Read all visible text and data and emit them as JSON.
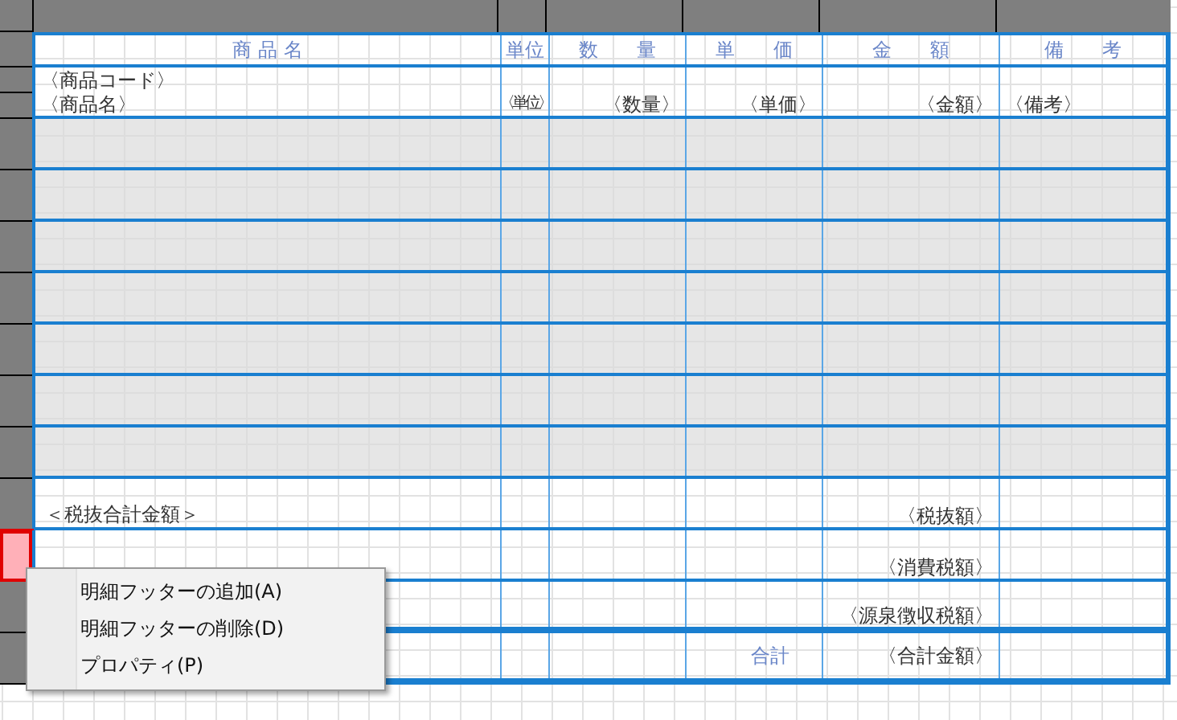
{
  "columns": [
    {
      "label": "商 品 名"
    },
    {
      "label": "単位"
    },
    {
      "label": "数　　量"
    },
    {
      "label": "単　　価"
    },
    {
      "label": "金　　額"
    },
    {
      "label": "備　　考"
    }
  ],
  "detail": {
    "code_field": "〈商品コード〉",
    "fields": [
      "〈商品名〉",
      "〈単位〉",
      "〈数量〉",
      "〈単価〉",
      "〈金額〉",
      "〈備考〉"
    ]
  },
  "footer_rows": [
    {
      "label": "＜税抜合計金額＞",
      "value": "〈税抜額〉",
      "selected": false
    },
    {
      "value": "〈消費税額〉",
      "selected": true
    },
    {
      "value": "〈源泉徴収税額〉",
      "selected": false
    }
  ],
  "total_row": {
    "label": "合計",
    "value": "〈合計金額〉"
  },
  "context_menu": {
    "items": [
      {
        "label": "明細フッターの追加(A)"
      },
      {
        "label": "明細フッターの削除(D)"
      },
      {
        "label": "プロパティ(P)"
      }
    ]
  }
}
